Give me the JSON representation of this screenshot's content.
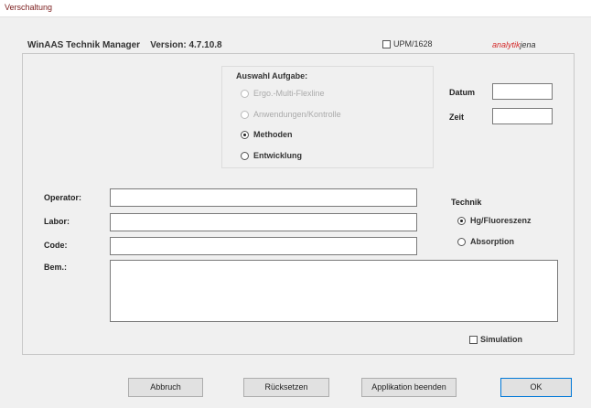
{
  "window": {
    "title": "Verschaltung"
  },
  "header": {
    "app_name": "WinAAS Technik Manager",
    "version_label": "Version:",
    "version": "4.7.10.8"
  },
  "upm": {
    "label": "UPM/1628",
    "checked": false
  },
  "logo": {
    "part1": "analytik",
    "part2": "jena",
    "brand_color": "#d42a2a"
  },
  "task_group": {
    "title": "Auswahl Aufgabe:",
    "options": [
      {
        "label": "Ergo.-Multi-Flexline",
        "selected": false,
        "enabled": false
      },
      {
        "label": "Anwendungen/Kontrolle",
        "selected": false,
        "enabled": false
      },
      {
        "label": "Methoden",
        "selected": true,
        "enabled": true
      },
      {
        "label": "Entwicklung",
        "selected": false,
        "enabled": true
      }
    ]
  },
  "datetime": {
    "date_label": "Datum",
    "date_value": "",
    "time_label": "Zeit",
    "time_value": ""
  },
  "form": {
    "operator_label": "Operator:",
    "operator_value": "",
    "labor_label": "Labor:",
    "labor_value": "",
    "code_label": "Code:",
    "code_value": "",
    "remark_label": "Bem.:",
    "remark_value": ""
  },
  "technique": {
    "title": "Technik",
    "options": [
      {
        "label": "Hg/Fluoreszenz",
        "selected": true
      },
      {
        "label": "Absorption",
        "selected": false
      }
    ]
  },
  "simulation": {
    "label": "Simulation",
    "checked": false
  },
  "buttons": {
    "close": "Abbruch",
    "reset": "Rücksetzen",
    "end_app": "Applikation beenden",
    "ok": "OK"
  }
}
